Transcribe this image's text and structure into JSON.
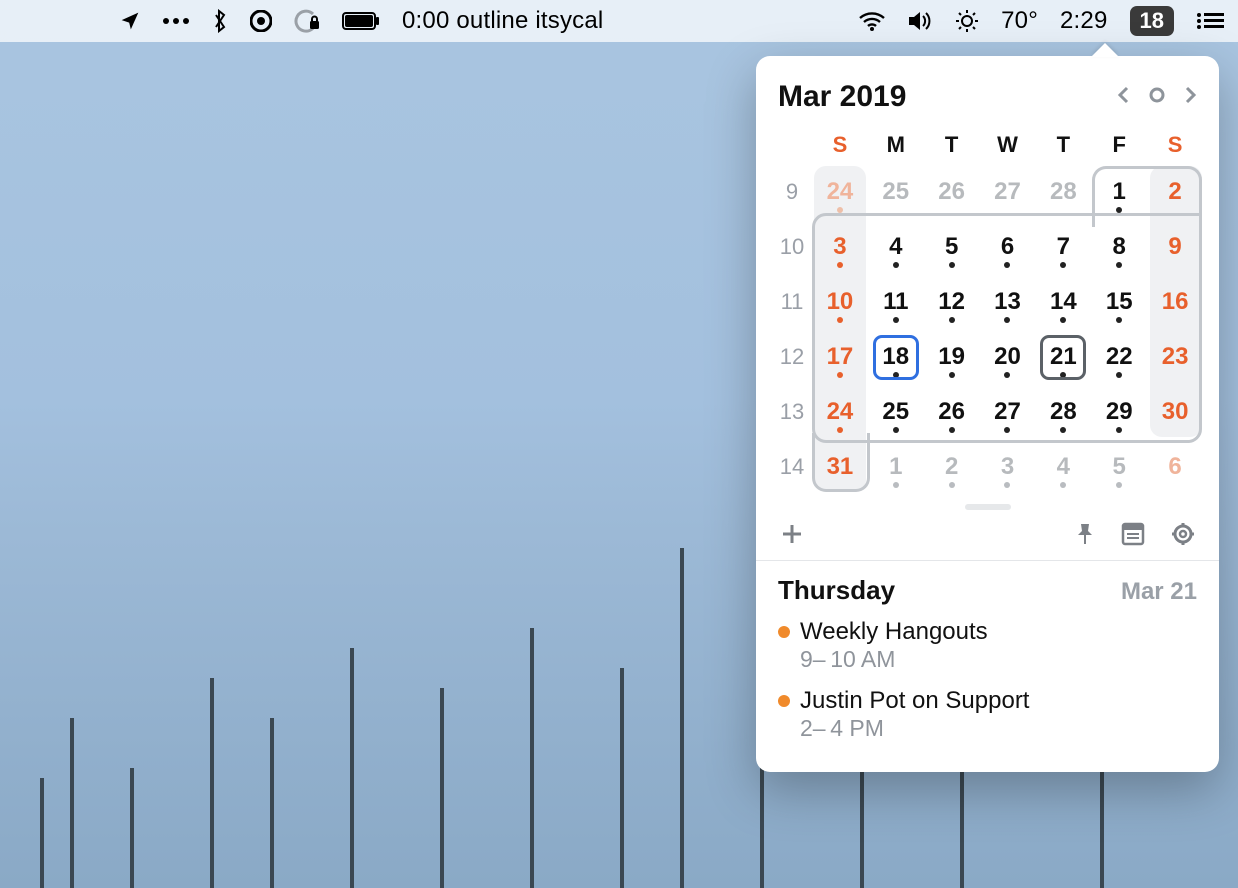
{
  "menubar": {
    "nowplaying": "0:00 outline itsycal",
    "temperature": "70°",
    "clock": "2:29",
    "date_pill": "18"
  },
  "calendar": {
    "title": "Mar 2019",
    "dow": [
      "S",
      "M",
      "T",
      "W",
      "T",
      "F",
      "S"
    ],
    "week_numbers": [
      "9",
      "10",
      "11",
      "12",
      "13",
      "14"
    ],
    "rows": [
      [
        {
          "n": "24",
          "dim": true,
          "dot": true,
          "wday": "sun"
        },
        {
          "n": "25",
          "dim": true,
          "dot": false,
          "wday": "mon"
        },
        {
          "n": "26",
          "dim": true,
          "dot": false,
          "wday": "tue"
        },
        {
          "n": "27",
          "dim": true,
          "dot": false,
          "wday": "wed"
        },
        {
          "n": "28",
          "dim": true,
          "dot": false,
          "wday": "thu"
        },
        {
          "n": "1",
          "dim": false,
          "dot": true,
          "wday": "fri"
        },
        {
          "n": "2",
          "dim": false,
          "dot": false,
          "wday": "sat"
        }
      ],
      [
        {
          "n": "3",
          "dim": false,
          "dot": true,
          "wday": "sun"
        },
        {
          "n": "4",
          "dim": false,
          "dot": true,
          "wday": "mon"
        },
        {
          "n": "5",
          "dim": false,
          "dot": true,
          "wday": "tue"
        },
        {
          "n": "6",
          "dim": false,
          "dot": true,
          "wday": "wed"
        },
        {
          "n": "7",
          "dim": false,
          "dot": true,
          "wday": "thu"
        },
        {
          "n": "8",
          "dim": false,
          "dot": true,
          "wday": "fri"
        },
        {
          "n": "9",
          "dim": false,
          "dot": false,
          "wday": "sat"
        }
      ],
      [
        {
          "n": "10",
          "dim": false,
          "dot": true,
          "wday": "sun"
        },
        {
          "n": "11",
          "dim": false,
          "dot": true,
          "wday": "mon"
        },
        {
          "n": "12",
          "dim": false,
          "dot": true,
          "wday": "tue"
        },
        {
          "n": "13",
          "dim": false,
          "dot": true,
          "wday": "wed"
        },
        {
          "n": "14",
          "dim": false,
          "dot": true,
          "wday": "thu"
        },
        {
          "n": "15",
          "dim": false,
          "dot": true,
          "wday": "fri"
        },
        {
          "n": "16",
          "dim": false,
          "dot": false,
          "wday": "sat"
        }
      ],
      [
        {
          "n": "17",
          "dim": false,
          "dot": true,
          "wday": "sun"
        },
        {
          "n": "18",
          "dim": false,
          "dot": true,
          "wday": "mon",
          "today": true
        },
        {
          "n": "19",
          "dim": false,
          "dot": true,
          "wday": "tue"
        },
        {
          "n": "20",
          "dim": false,
          "dot": true,
          "wday": "wed"
        },
        {
          "n": "21",
          "dim": false,
          "dot": true,
          "wday": "thu",
          "selected": true
        },
        {
          "n": "22",
          "dim": false,
          "dot": true,
          "wday": "fri"
        },
        {
          "n": "23",
          "dim": false,
          "dot": false,
          "wday": "sat"
        }
      ],
      [
        {
          "n": "24",
          "dim": false,
          "dot": true,
          "wday": "sun"
        },
        {
          "n": "25",
          "dim": false,
          "dot": true,
          "wday": "mon"
        },
        {
          "n": "26",
          "dim": false,
          "dot": true,
          "wday": "tue"
        },
        {
          "n": "27",
          "dim": false,
          "dot": true,
          "wday": "wed"
        },
        {
          "n": "28",
          "dim": false,
          "dot": true,
          "wday": "thu"
        },
        {
          "n": "29",
          "dim": false,
          "dot": true,
          "wday": "fri"
        },
        {
          "n": "30",
          "dim": false,
          "dot": false,
          "wday": "sat"
        }
      ],
      [
        {
          "n": "31",
          "dim": false,
          "dot": false,
          "wday": "sun"
        },
        {
          "n": "1",
          "dim": true,
          "dot": true,
          "wday": "mon"
        },
        {
          "n": "2",
          "dim": true,
          "dot": true,
          "wday": "tue"
        },
        {
          "n": "3",
          "dim": true,
          "dot": true,
          "wday": "wed"
        },
        {
          "n": "4",
          "dim": true,
          "dot": true,
          "wday": "thu"
        },
        {
          "n": "5",
          "dim": true,
          "dot": true,
          "wday": "fri"
        },
        {
          "n": "6",
          "dim": true,
          "dot": false,
          "wday": "sat"
        }
      ]
    ],
    "selected_header": {
      "dayname": "Thursday",
      "date": "Mar 21"
    },
    "events": [
      {
        "title": "Weekly Hangouts",
        "time": "9– 10 AM",
        "color": "#f08a2b"
      },
      {
        "title": "Justin Pot on Support",
        "time": "2– 4 PM",
        "color": "#f08a2b"
      }
    ]
  }
}
